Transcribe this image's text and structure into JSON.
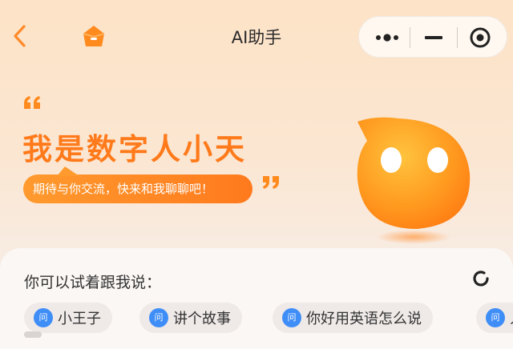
{
  "header": {
    "title": "AI助手",
    "back_icon": "chevron-left-icon",
    "home_icon": "home-icon",
    "capsule": {
      "more_icon": "more-dots-icon",
      "minimize_icon": "minimize-icon",
      "close_icon": "target-close-icon"
    }
  },
  "hero": {
    "headline": "我是数字人小天",
    "tagline": "期待与你交流，快来和我聊聊吧！",
    "open_quote": "❝",
    "close_quote": "❞",
    "mascot_icon": "mascot-xiaotian"
  },
  "suggestions": {
    "title": "你可以试着跟我说：",
    "refresh_icon": "refresh-icon",
    "chip_icon_text": "问",
    "items": [
      {
        "label": "小王子"
      },
      {
        "label": "讲个故事"
      },
      {
        "label": "你好用英语怎么说"
      },
      {
        "label": "人"
      }
    ]
  },
  "colors": {
    "accent": "#ff7a1a",
    "chip_icon": "#3f8ef7",
    "background_top": "#fde3c7"
  }
}
